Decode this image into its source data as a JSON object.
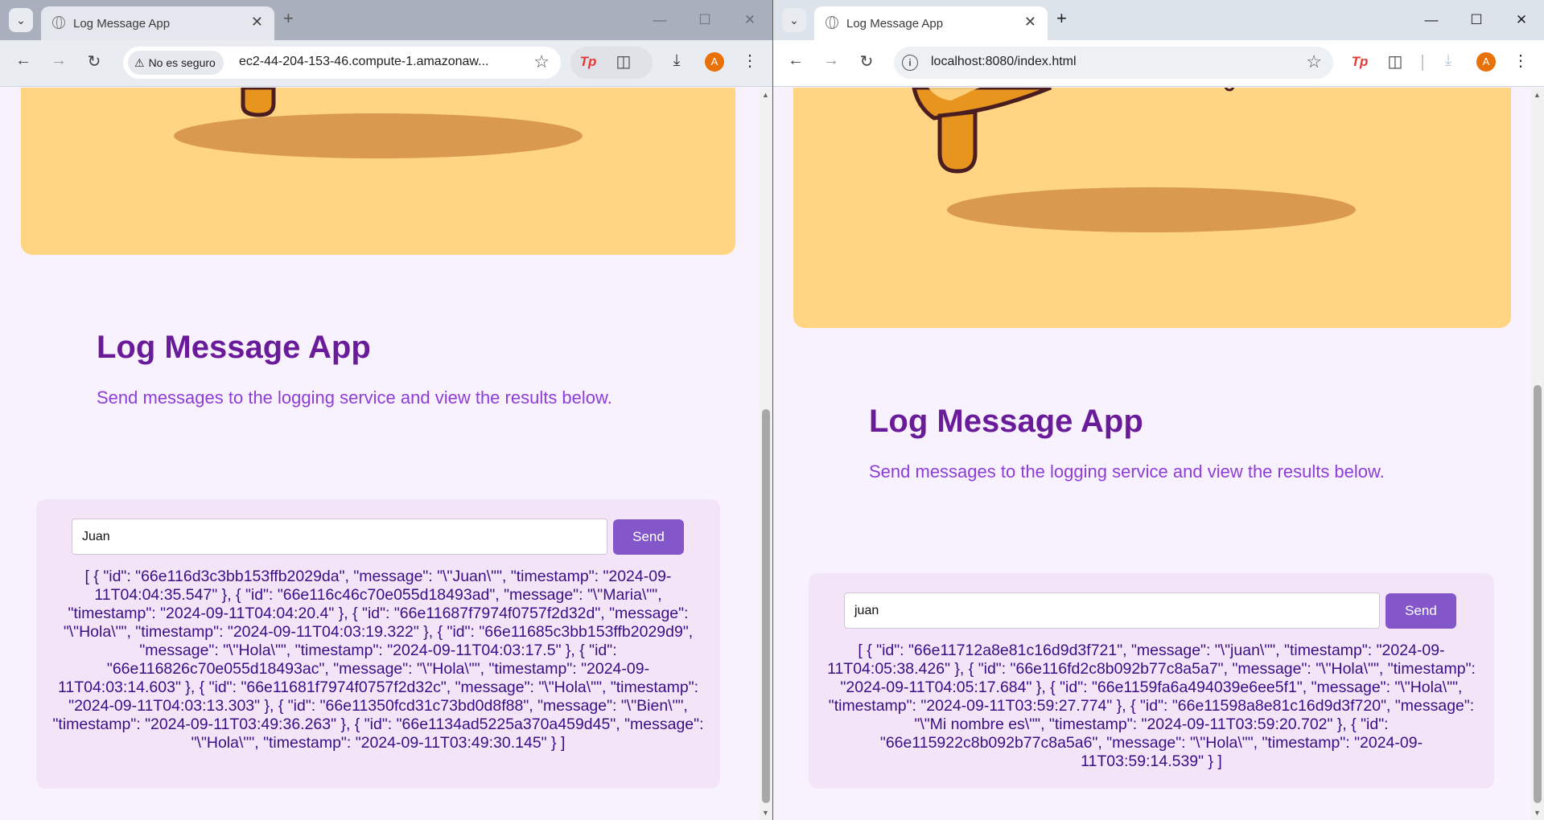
{
  "left_window": {
    "tab_title": "Log Message App",
    "security_label": "No es seguro",
    "url": "ec2-44-204-153-46.compute-1.amazonaw...",
    "page": {
      "title": "Log Message App",
      "subtitle": "Send messages to the logging service and view the results below.",
      "input_value": "Juan",
      "send_label": "Send",
      "results": "[ { \"id\": \"66e116d3c3bb153ffb2029da\", \"message\": \"\\\"Juan\\\"\", \"timestamp\": \"2024-09-11T04:04:35.547\" }, { \"id\": \"66e116c46c70e055d18493ad\", \"message\": \"\\\"Maria\\\"\", \"timestamp\": \"2024-09-11T04:04:20.4\" }, { \"id\": \"66e11687f7974f0757f2d32d\", \"message\": \"\\\"Hola\\\"\", \"timestamp\": \"2024-09-11T04:03:19.322\" }, { \"id\": \"66e11685c3bb153ffb2029d9\", \"message\": \"\\\"Hola\\\"\", \"timestamp\": \"2024-09-11T04:03:17.5\" }, { \"id\": \"66e116826c70e055d18493ac\", \"message\": \"\\\"Hola\\\"\", \"timestamp\": \"2024-09-11T04:03:14.603\" }, { \"id\": \"66e11681f7974f0757f2d32c\", \"message\": \"\\\"Hola\\\"\", \"timestamp\": \"2024-09-11T04:03:13.303\" }, { \"id\": \"66e11350fcd31c73bd0d8f88\", \"message\": \"\\\"Bien\\\"\", \"timestamp\": \"2024-09-11T03:49:36.263\" }, { \"id\": \"66e1134ad5225a370a459d45\", \"message\": \"\\\"Hola\\\"\", \"timestamp\": \"2024-09-11T03:49:30.145\" } ]"
    }
  },
  "right_window": {
    "tab_title": "Log Message App",
    "url": "localhost:8080/index.html",
    "page": {
      "title": "Log Message App",
      "subtitle": "Send messages to the logging service and view the results below.",
      "input_value": "juan",
      "send_label": "Send",
      "results": "[ { \"id\": \"66e11712a8e81c16d9d3f721\", \"message\": \"\\\"juan\\\"\", \"timestamp\": \"2024-09-11T04:05:38.426\" }, { \"id\": \"66e116fd2c8b092b77c8a5a7\", \"message\": \"\\\"Hola\\\"\", \"timestamp\": \"2024-09-11T04:05:17.684\" }, { \"id\": \"66e1159fa6a494039e6ee5f1\", \"message\": \"\\\"Hola\\\"\", \"timestamp\": \"2024-09-11T03:59:27.774\" }, { \"id\": \"66e11598a8e81c16d9d3f720\", \"message\": \"\\\"Mi nombre es\\\"\", \"timestamp\": \"2024-09-11T03:59:20.702\" }, { \"id\": \"66e115922c8b092b77c8a5a6\", \"message\": \"\\\"Hola\\\"\", \"timestamp\": \"2024-09-11T03:59:14.539\" } ]"
    }
  },
  "icons": {
    "tab_search": "chevron-down-icon",
    "favicon": "globe-icon",
    "close": "close-icon",
    "new_tab": "plus-icon",
    "back": "arrow-left-icon",
    "forward": "arrow-right-icon",
    "reload": "reload-icon",
    "warning": "warning-icon",
    "info": "info-icon",
    "bookmark": "star-icon",
    "extension_tp": "tp-extension-icon",
    "extensions": "puzzle-icon",
    "download": "download-icon",
    "profile_initial": "A",
    "menu": "kebab-menu-icon"
  },
  "colors": {
    "title": "#6a1b9a",
    "subtitle": "#8e3dd6",
    "hero_background": "#ffd583",
    "panel_background": "#f3e4f7",
    "send_button": "#8357c9",
    "results_text": "#3a0f86",
    "page_background": "#f8f2ff"
  },
  "scroll": {
    "left_thumb_position": 0.4,
    "right_thumb_position": 0.35
  }
}
